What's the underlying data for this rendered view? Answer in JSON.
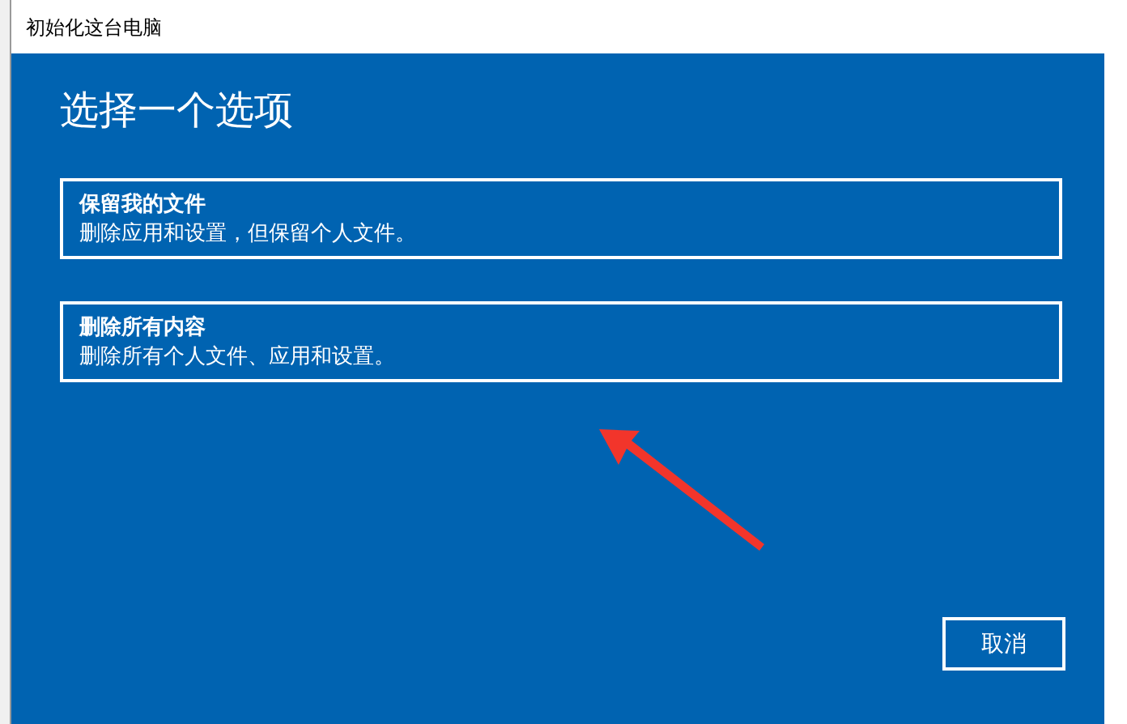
{
  "window": {
    "title": "初始化这台电脑"
  },
  "heading": "选择一个选项",
  "options": [
    {
      "title": "保留我的文件",
      "description": "删除应用和设置，但保留个人文件。"
    },
    {
      "title": "删除所有内容",
      "description": "删除所有个人文件、应用和设置。"
    }
  ],
  "buttons": [
    "取消"
  ]
}
